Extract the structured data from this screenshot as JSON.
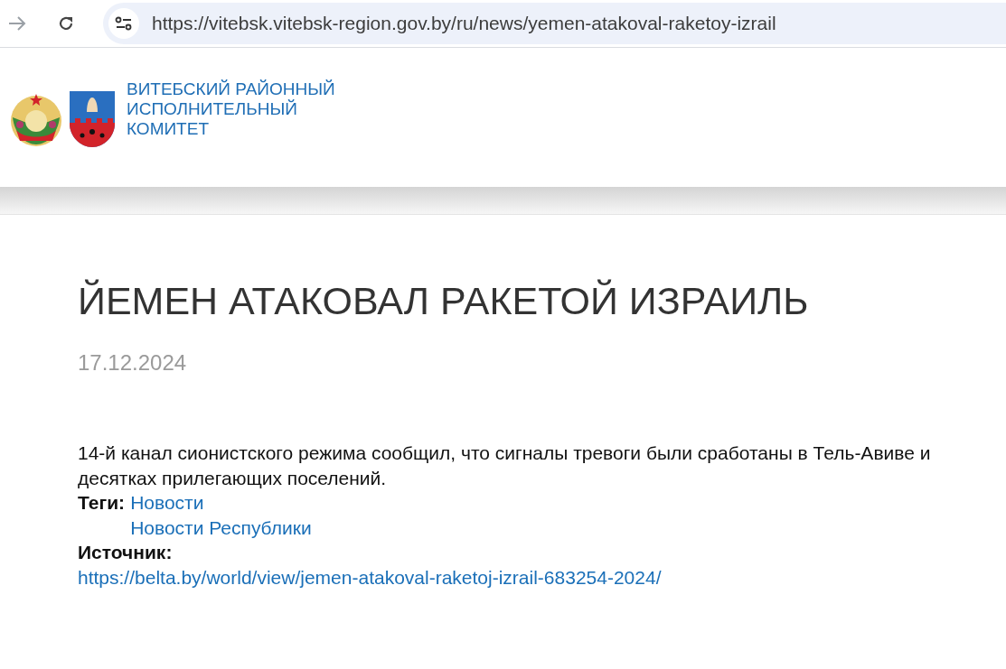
{
  "browser": {
    "url": "https://vitebsk.vitebsk-region.gov.by/ru/news/yemen-atakoval-raketoy-izrail"
  },
  "header": {
    "org_name": [
      "ВИТЕБСКИЙ РАЙОННЫЙ",
      "ИСПОЛНИТЕЛЬНЫЙ",
      "КОМИТЕТ"
    ]
  },
  "article": {
    "title": "ЙЕМЕН АТАКОВАЛ РАКЕТОЙ ИЗРАИЛЬ",
    "date": "17.12.2024",
    "body": "14-й канал сионистского режима сообщил, что сигналы тревоги были сработаны в Тель-Авиве и десятках прилегающих поселений.",
    "tags_label": "Теги:",
    "tags": [
      "Новости",
      "Новости Республики"
    ],
    "source_label": "Источник:",
    "source_url": "https://belta.by/world/view/jemen-atakoval-raketoj-izrail-683254-2024/"
  }
}
